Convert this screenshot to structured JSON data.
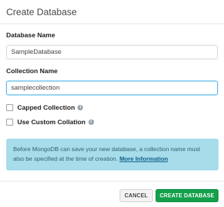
{
  "dialog": {
    "title": "Create Database",
    "database_name_label": "Database Name",
    "database_name_value": "SampleDatabase",
    "collection_name_label": "Collection Name",
    "collection_name_value": "samplecollection",
    "capped_collection_label": "Capped Collection",
    "custom_collation_label": "Use Custom Collation",
    "info_icon_glyph": "i",
    "info_text": "Before MongoDB can save your new database, a collection name must also be specified at the time of creation.",
    "info_link": "More Information",
    "cancel_label": "CANCEL",
    "create_label": "CREATE DATABASE",
    "colors": {
      "accent_green": "#13a04a",
      "info_bg": "#a7dceb",
      "focus_border": "#43b1e5"
    }
  }
}
